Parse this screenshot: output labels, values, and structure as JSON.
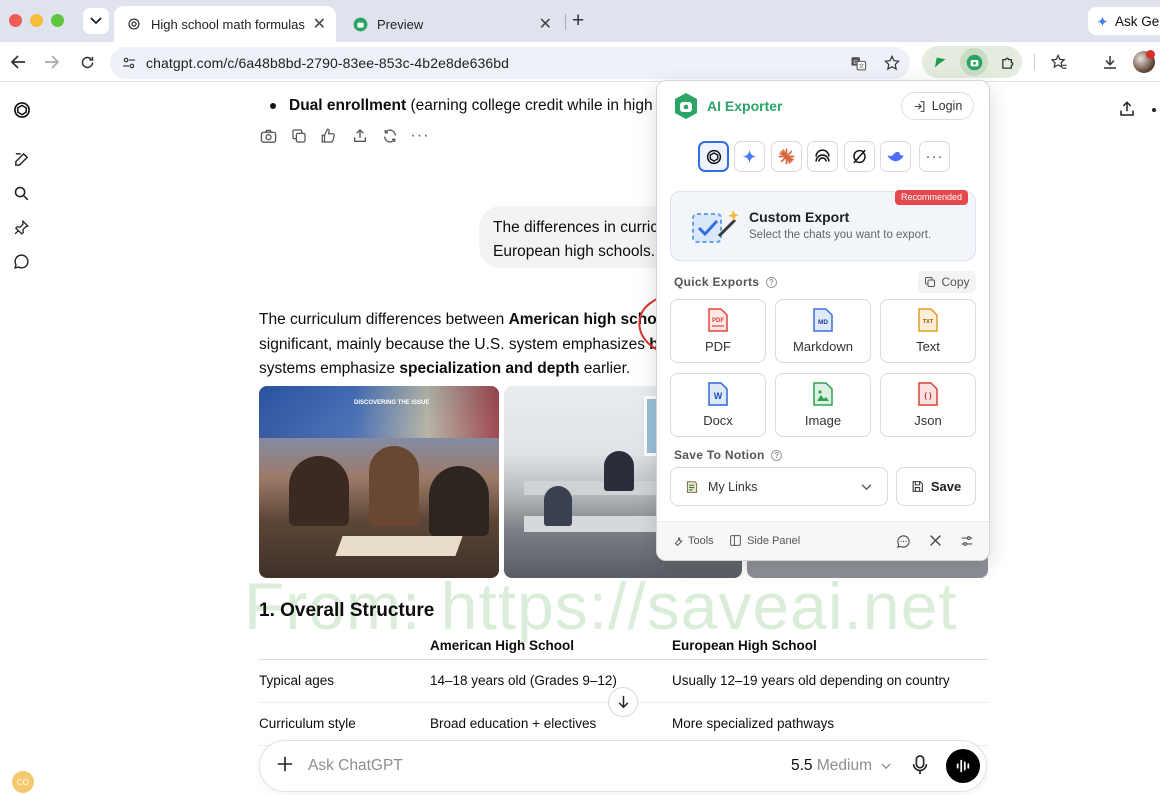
{
  "browser": {
    "tabs": [
      {
        "title": "High school math formulas",
        "active": true
      },
      {
        "title": "Preview",
        "active": false
      }
    ],
    "new_tab": "+",
    "gemini_button": "Ask Ge",
    "url": "chatgpt.com/c/6a48b8bd-2790-83ee-853c-4b2e8de636bd"
  },
  "chat": {
    "bullet": {
      "bold": "Dual enrollment",
      "rest": " (earning college credit while in high s"
    },
    "user_message": [
      "The differences in curric",
      "European high schools."
    ],
    "paragraph": {
      "l1_a": "The curriculum differences between ",
      "l1_b": "American high scho",
      "l2_a": "significant, mainly because the U.S. system emphasizes ",
      "l2_b": "b",
      "l3_a": "systems emphasize ",
      "l3_b": "specialization and depth",
      "l3_c": " earlier."
    },
    "photo_banner": "DISCOVERING THE ISSUE",
    "heading": "1. Overall Structure",
    "table": {
      "headers": [
        "",
        "American High School",
        "European High School"
      ],
      "rows": [
        [
          "Typical ages",
          "14–18 years old (Grades 9–12)",
          "Usually 12–19 years old depending on country"
        ],
        [
          "Curriculum style",
          "Broad education + electives",
          "More specialized pathways"
        ]
      ]
    },
    "watermark": "From: https://saveai.net",
    "composer": {
      "placeholder": "Ask ChatGPT",
      "model": "5.5",
      "mode": "Medium"
    },
    "avatar_initials": "CO"
  },
  "popup": {
    "brand": "AI Exporter",
    "login": "Login",
    "platforms": [
      "chatgpt-icon",
      "gemini-icon",
      "claude-icon",
      "perplexity-icon",
      "grok-icon",
      "deepseek-icon",
      "more-icon"
    ],
    "custom_export": {
      "badge": "Recommended",
      "title": "Custom Export",
      "subtitle": "Select the chats you want to export."
    },
    "quick_exports_label": "Quick Exports",
    "copy": "Copy",
    "formats": [
      {
        "label": "PDF",
        "tag": "PDF",
        "color": "#e0443e"
      },
      {
        "label": "Markdown",
        "tag": "MD",
        "color": "#3b6fd8"
      },
      {
        "label": "Text",
        "tag": "TXT",
        "color": "#e39a2c"
      },
      {
        "label": "Docx",
        "tag": "W",
        "color": "#2f67d1"
      },
      {
        "label": "Image",
        "tag": "",
        "color": "#2fa352"
      },
      {
        "label": "Json",
        "tag": "{ }",
        "color": "#d9423b"
      }
    ],
    "notion_label": "Save To Notion",
    "notion_select": "My Links",
    "save": "Save",
    "footer": {
      "tools": "Tools",
      "side_panel": "Side Panel"
    },
    "accent": "#2aa566"
  }
}
